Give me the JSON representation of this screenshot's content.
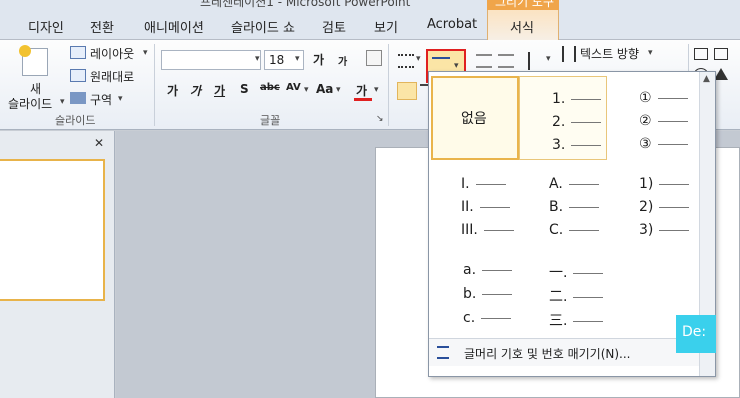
{
  "window": {
    "title": "프레젠테이션1 - Microsoft PowerPoint",
    "context_tab_band": "그리기 도구"
  },
  "tabs": [
    "디자인",
    "전환",
    "애니메이션",
    "슬라이드 쇼",
    "검토",
    "보기",
    "Acrobat",
    "서식"
  ],
  "ribbon": {
    "slides_group": {
      "label": "슬라이드",
      "new_slide_line1": "새",
      "new_slide_line2": "슬라이드",
      "layout": "레이아웃",
      "reset": "원래대로",
      "section": "구역"
    },
    "font_group": {
      "label": "글꼴",
      "font_name": "",
      "font_size": "18",
      "grow": "가",
      "shrink": "가",
      "bold": "가",
      "italic": "가",
      "underline": "가",
      "shadow": "S",
      "strike": "abc",
      "spacing": "AV",
      "case": "Aa",
      "font_color": "가"
    },
    "paragraph_group": {
      "text_direction": "텍스트 방향"
    }
  },
  "gallery": {
    "none_label": "없음",
    "numbered_arabic": [
      "1.",
      "2.",
      "3."
    ],
    "numbered_circled": [
      "①",
      "②",
      "③"
    ],
    "roman_upper": [
      "I.",
      "II.",
      "III."
    ],
    "alpha_upper": [
      "A.",
      "B.",
      "C."
    ],
    "numbered_paren": [
      "1)",
      "2)",
      "3)"
    ],
    "alpha_lower": [
      "a.",
      "b.",
      "c."
    ],
    "korean_numerals": [
      "一.",
      "二.",
      "三."
    ],
    "footer_label": "글머리 기호 및 번호 매기기(N)..."
  },
  "tooltip": {
    "text": "De:"
  },
  "colors": {
    "selection_border": "#e9b44c",
    "highlight_red": "#e02020",
    "context_tab": "#f0a54a",
    "tooltip": "#3ad0ec"
  }
}
